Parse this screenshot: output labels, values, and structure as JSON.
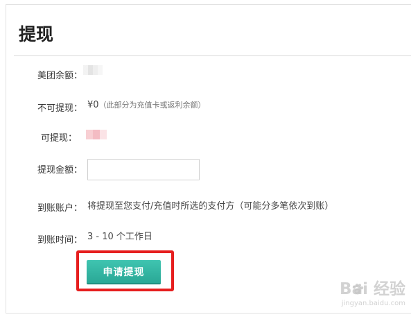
{
  "page": {
    "title": "提现"
  },
  "rows": {
    "balance_label": "美团余额：",
    "non_withdrawable_label": "不可提现：",
    "non_withdrawable_value": "¥0",
    "non_withdrawable_note": "（此部分为充值卡或返利余额）",
    "withdrawable_label": "可提现：",
    "amount_label": "提现金额：",
    "amount_value": "",
    "account_label": "到账账户：",
    "account_value": "将提现至您支付/充值时所选的支付方（可能分多笔依次到账）",
    "time_label": "到账时间：",
    "time_value": "3 - 10 个工作日"
  },
  "actions": {
    "submit_label": "申请提现"
  },
  "watermark": {
    "brand": "Bai 经验",
    "url": "jingyan.baidu.com"
  },
  "colors": {
    "button": "#2fb39f",
    "highlight": "#e61e1e",
    "divider": "#d9d9d9"
  }
}
